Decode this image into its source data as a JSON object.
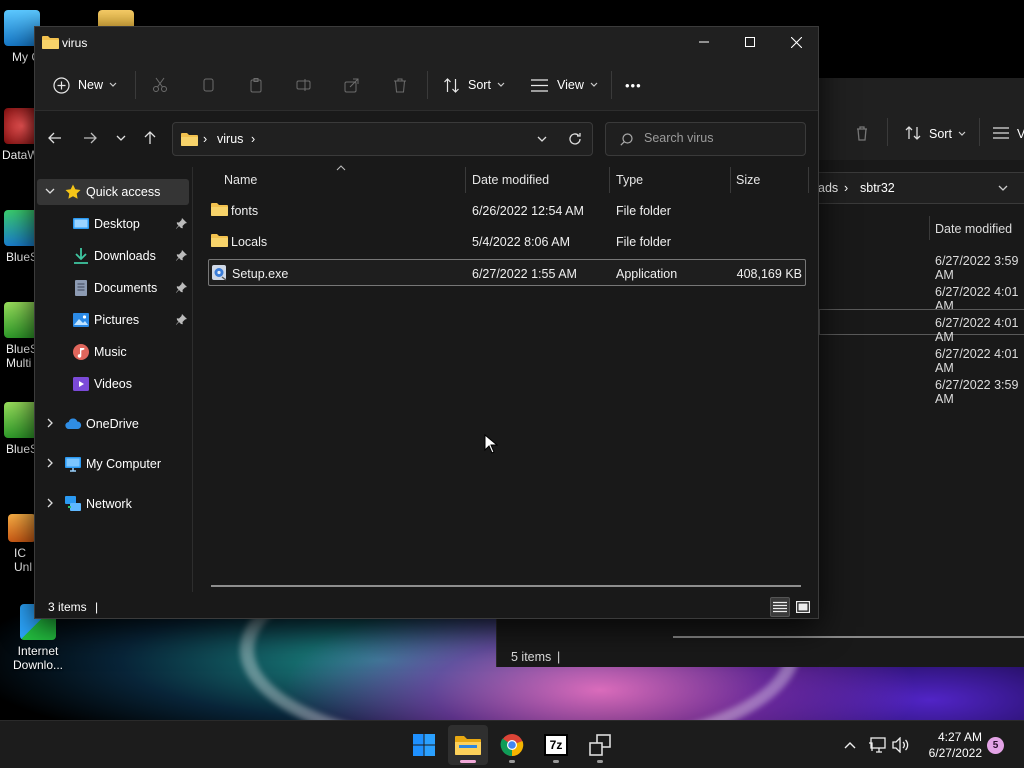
{
  "desktop": {
    "icons": [
      {
        "label": "My Co",
        "name": "my-computer"
      },
      {
        "label": "DataW",
        "name": "dataw"
      },
      {
        "label": "BlueS",
        "name": "bluestacks"
      },
      {
        "label": "BlueS\nMulti",
        "name": "bluestacks-multi"
      },
      {
        "label": "BlueS",
        "name": "bluestacks-2"
      },
      {
        "label": "IC\nUnl",
        "name": "ic-unl"
      },
      {
        "label": "Internet\nDownlo...",
        "name": "internet-download"
      }
    ]
  },
  "back_window": {
    "toolbar": {
      "sort_label": "Sort",
      "view_label_partial": "V"
    },
    "breadcrumb": [
      "ads",
      "sbtr32"
    ],
    "column_header": "Date modified",
    "rows": [
      "6/27/2022 3:59 AM",
      "6/27/2022 4:01 AM",
      "6/27/2022 4:01 AM",
      "6/27/2022 4:01 AM",
      "6/27/2022 3:59 AM"
    ],
    "status": "5 items"
  },
  "window": {
    "title": "virus",
    "toolbar": {
      "new_label": "New",
      "sort_label": "Sort",
      "view_label": "View",
      "more_label": "•••"
    },
    "address": {
      "segments": [
        "virus"
      ]
    },
    "search": {
      "placeholder": "Search virus"
    },
    "nav": {
      "quick_access": "Quick access",
      "items": [
        {
          "label": "Desktop",
          "pinned": true
        },
        {
          "label": "Downloads",
          "pinned": true
        },
        {
          "label": "Documents",
          "pinned": true
        },
        {
          "label": "Pictures",
          "pinned": true
        },
        {
          "label": "Music",
          "pinned": false
        },
        {
          "label": "Videos",
          "pinned": false
        }
      ],
      "onedrive": "OneDrive",
      "my_computer": "My Computer",
      "network": "Network"
    },
    "columns": {
      "name": "Name",
      "date": "Date modified",
      "type": "Type",
      "size": "Size"
    },
    "files": [
      {
        "name": "fonts",
        "date": "6/26/2022 12:54 AM",
        "type": "File folder",
        "size": "",
        "icon": "folder-icon"
      },
      {
        "name": "Locals",
        "date": "5/4/2022 8:06 AM",
        "type": "File folder",
        "size": "",
        "icon": "folder-icon"
      },
      {
        "name": "Setup.exe",
        "date": "6/27/2022 1:55 AM",
        "type": "Application",
        "size": "408,169 KB",
        "icon": "installer-icon"
      }
    ],
    "status": "3 items"
  },
  "taskbar": {
    "apps": [
      "windows-start",
      "file-explorer",
      "chrome",
      "7zip",
      "task-view"
    ],
    "seven_zip_label": "7z",
    "clock_time": "4:27 AM",
    "clock_date": "6/27/2022",
    "notification_count": "5"
  },
  "colors": {
    "accent_folder": "#f2c14e",
    "selection_pink": "#f0a8d8"
  }
}
